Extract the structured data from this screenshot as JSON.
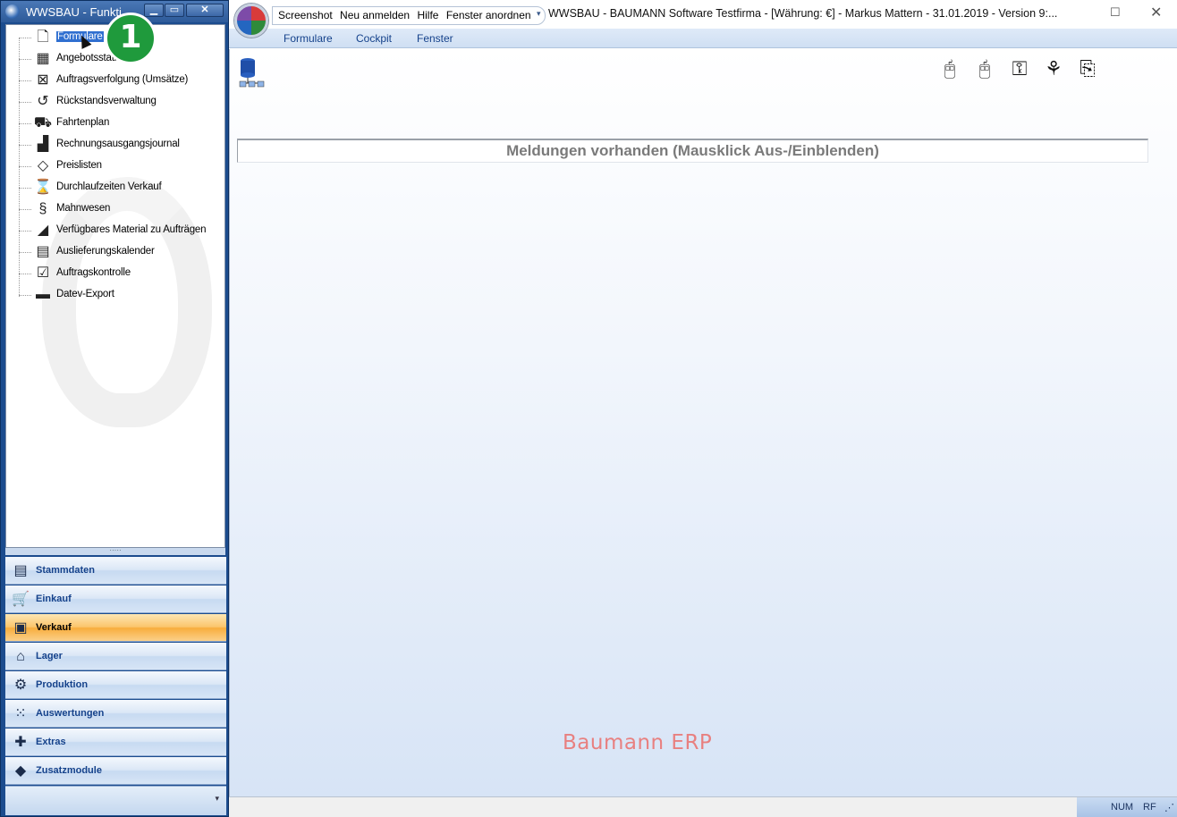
{
  "left_window": {
    "title": "WWSBAU - Funkti",
    "minimize": "▁",
    "maximize": "▭",
    "close": "✕",
    "tree_items": [
      {
        "label": "Formulare",
        "icon": "document-icon",
        "glyph": "🗋"
      },
      {
        "label": "Angebotsstatis",
        "icon": "chart-sheet-icon",
        "glyph": "▦"
      },
      {
        "label": "Auftragsverfolgung (Umsätze)",
        "icon": "tracking-icon",
        "glyph": "⊠"
      },
      {
        "label": "Rückstandsverwaltung",
        "icon": "history-icon",
        "glyph": "↺"
      },
      {
        "label": "Fahrtenplan",
        "icon": "truck-icon",
        "glyph": "⛟"
      },
      {
        "label": "Rechnungsausgangsjournal",
        "icon": "journal-icon",
        "glyph": "▟"
      },
      {
        "label": "Preislisten",
        "icon": "price-tag-icon",
        "glyph": "◇"
      },
      {
        "label": "Durchlaufzeiten Verkauf",
        "icon": "hourglass-icon",
        "glyph": "⌛"
      },
      {
        "label": "Mahnwesen",
        "icon": "dunning-icon",
        "glyph": "§"
      },
      {
        "label": "Verfügbares Material zu Aufträgen",
        "icon": "material-icon",
        "glyph": "◢"
      },
      {
        "label": "Auslieferungskalender",
        "icon": "calendar-icon",
        "glyph": "▤"
      },
      {
        "label": "Auftragskontrolle",
        "icon": "clipboard-check-icon",
        "glyph": "☑"
      },
      {
        "label": "Datev-Export",
        "icon": "datev-icon",
        "glyph": "▬"
      }
    ],
    "badge": "1",
    "splitter": "·····",
    "nav": [
      {
        "label": "Stammdaten",
        "icon": "master-data-icon",
        "glyph": "▤"
      },
      {
        "label": "Einkauf",
        "icon": "shopping-cart-icon",
        "glyph": "🛒"
      },
      {
        "label": "Verkauf",
        "icon": "cash-register-icon",
        "glyph": "▣"
      },
      {
        "label": "Lager",
        "icon": "warehouse-icon",
        "glyph": "⌂"
      },
      {
        "label": "Produktion",
        "icon": "production-icon",
        "glyph": "⚙"
      },
      {
        "label": "Auswertungen",
        "icon": "analytics-icon",
        "glyph": "⁙"
      },
      {
        "label": "Extras",
        "icon": "puzzle-icon",
        "glyph": "✚"
      },
      {
        "label": "Zusatzmodule",
        "icon": "modules-icon",
        "glyph": "◆"
      }
    ],
    "nav_footer_chevron": "▾"
  },
  "main_window": {
    "quick_access": [
      "Screenshot",
      "Neu anmelden",
      "Hilfe",
      "Fenster anordnen"
    ],
    "dropdown": "▾",
    "title": "WWSBAU - BAUMANN Software Testfirma - [Währung: €] -   Markus Mattern - 31.01.2019 - Version 9:...",
    "maximize": "☐",
    "close": "✕",
    "menu": [
      "Formulare",
      "Cockpit",
      "Fenster"
    ],
    "toolbar_icons": [
      {
        "name": "mouse-left-icon",
        "glyph": "🖰"
      },
      {
        "name": "mouse-right-icon",
        "glyph": "🖰"
      },
      {
        "name": "key-icon",
        "glyph": "⚿"
      },
      {
        "name": "network-icon",
        "glyph": "⚘"
      },
      {
        "name": "copy-documents-icon",
        "glyph": "⎘"
      }
    ],
    "messages_bar": "Meldungen vorhanden  (Mausklick Aus-/Einblenden)",
    "brand": "Baumann ERP",
    "status": {
      "num": "NUM",
      "rf": "RF",
      "grip": "⋰"
    }
  }
}
